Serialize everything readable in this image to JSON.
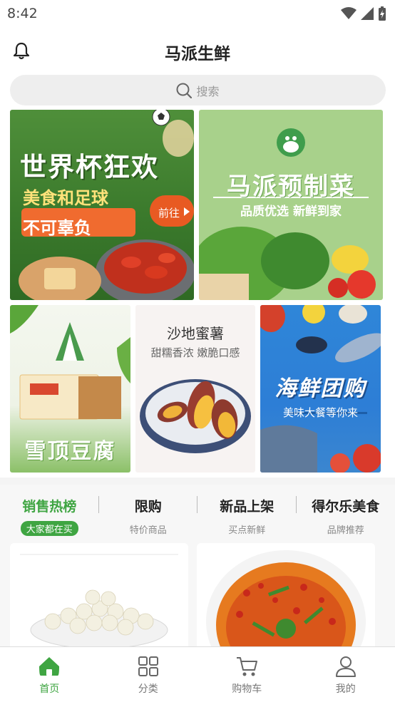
{
  "status": {
    "time": "8:42"
  },
  "header": {
    "title": "马派生鲜"
  },
  "search": {
    "placeholder": "搜索"
  },
  "banners": {
    "worldcup": {
      "line1": "世界杯狂欢",
      "line2": "美食和足球",
      "line3": "不可辜负",
      "cta": "前往"
    },
    "prepared": {
      "title": "马派预制菜",
      "subtitle": "品质优选 新鲜到家"
    },
    "tofu": {
      "title": "雪顶豆腐"
    },
    "sweetpotato": {
      "title": "沙地蜜薯",
      "subtitle": "甜糯香浓 嫩脆口感"
    },
    "seafood": {
      "title": "海鲜团购",
      "subtitle": "美味大餐等你来"
    }
  },
  "tabs": [
    {
      "title": "销售热榜",
      "sub": "大家都在买"
    },
    {
      "title": "限购",
      "sub": "特价商品"
    },
    {
      "title": "新品上架",
      "sub": "买点新鲜"
    },
    {
      "title": "得尔乐美食",
      "sub": "品牌推荐"
    }
  ],
  "nav": [
    {
      "label": "首页"
    },
    {
      "label": "分类"
    },
    {
      "label": "购物车"
    },
    {
      "label": "我的"
    }
  ],
  "colors": {
    "accent": "#3fa542",
    "bg": "#f7f7f7"
  }
}
